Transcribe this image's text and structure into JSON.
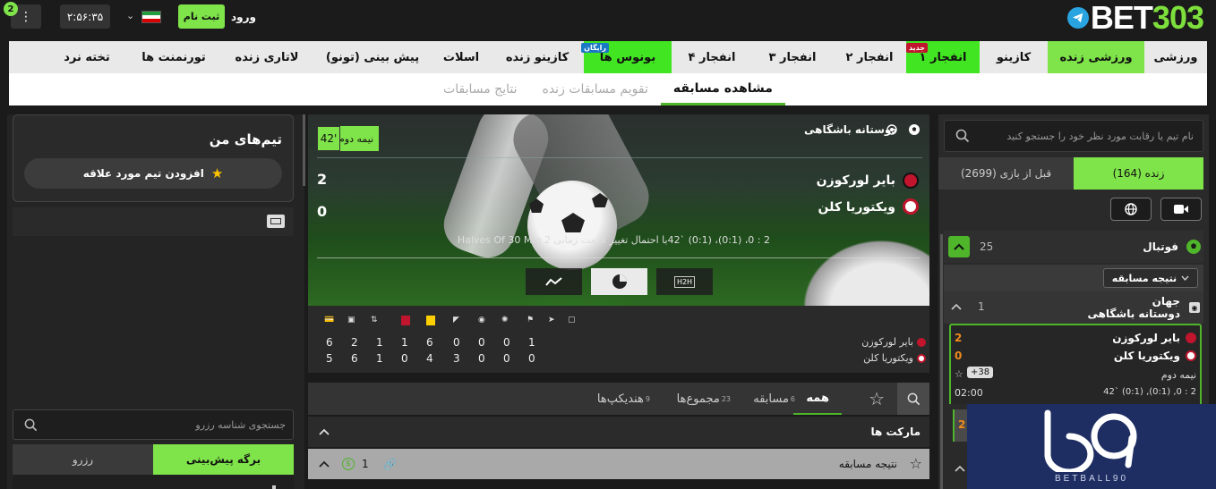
{
  "header": {
    "logo_text": "BET303",
    "login": "ورود",
    "signup": "ثبت نام",
    "clock": "۲:۵۶:۳۵",
    "menu_badge": "2"
  },
  "nav": {
    "items": [
      {
        "label": "ورزشی"
      },
      {
        "label": "ورزشی زنده",
        "active": true
      },
      {
        "label": "کازینو"
      },
      {
        "label": "انفجار ۱",
        "tag": "جدید",
        "highlight": true
      },
      {
        "label": "انفجار ۲"
      },
      {
        "label": "انفجار ۳"
      },
      {
        "label": "انفجار ۴"
      },
      {
        "label": "بونوس ها",
        "tag": "رایگان",
        "highlight": true
      },
      {
        "label": "کازینو زنده"
      },
      {
        "label": "اسلات"
      },
      {
        "label": "پیش بینی (تونو)"
      },
      {
        "label": "لاتاری زنده"
      },
      {
        "label": "تورنمنت ها"
      },
      {
        "label": "تخته نرد"
      }
    ],
    "tag_new": "جدید",
    "tag_free": "رایگان"
  },
  "subnav": {
    "items": [
      "مشاهده مسابقه",
      "تقویم مسابقات زنده",
      "نتایج مسابقات"
    ],
    "active": 0
  },
  "sidebar_right": {
    "search_placeholder": "نام تیم یا رقابت مورد نظر خود را جستجو کنید",
    "tab_live": "زنده (164)",
    "tab_prematch": "قبل از بازی (2699)",
    "sport": {
      "name": "فوتبال",
      "count": "25"
    },
    "filter_label": "نتیجه مسابقه",
    "league": {
      "country": "جهان",
      "name": "دوستانه باشگاهی",
      "count": "1"
    },
    "match": {
      "home": "بایر لورکوزن",
      "away": "ویکتوریا کلن",
      "home_score": "2",
      "away_score": "0",
      "period": "نیمه دوم",
      "markets_count": "+38",
      "time": "02:00",
      "detail": "42` (0:1) ,(0:1) ,0 : 2",
      "next_score": "2"
    }
  },
  "match_center": {
    "competition": "دوستانه باشگاهی",
    "period": "نیمه دوم",
    "minute": "42'",
    "home": "بایر لورکوزن",
    "away": "ویکتوریا کلن",
    "home_score": "2",
    "away_score": "0",
    "info": "2 : 0، (0:1)، (0:1) `42با احتمال تغییر فرمت زمانی 2 Halves Of 30 Min",
    "h2h": "H2H",
    "stats": {
      "home_name": "بایر لورکوزن",
      "away_name": "ویکتوریا کلن",
      "home": [
        "1",
        "0",
        "0",
        "0",
        "6",
        "1",
        "1",
        "2",
        "6"
      ],
      "away": [
        "0",
        "0",
        "0",
        "3",
        "4",
        "0",
        "1",
        "6",
        "5"
      ]
    }
  },
  "market_tabs": {
    "items": [
      {
        "label": "همه",
        "count": ""
      },
      {
        "label": "مسابقه",
        "count": "6"
      },
      {
        "label": "مجموع‌ها",
        "count": "23"
      },
      {
        "label": "هندیکپ‌ها",
        "count": "9"
      }
    ],
    "markets_label": "مارکت ها",
    "result_label": "نتیجه مسابقه",
    "result_count": "1"
  },
  "sidebar_left": {
    "my_teams_title": "تیم‌های من",
    "add_favorite": "افزودن تیم مورد علاقه",
    "reserve_search_placeholder": "جستجوی شناسه رزرو",
    "tab_slip": "برگه پیش‌بینی",
    "tab_reserve": "رزرو"
  },
  "watermark": {
    "text": "BETBALL90"
  },
  "colors": {
    "accent": "#7fe34a",
    "background": "#1b1b1b",
    "nav_bg": "#e9e9e9"
  }
}
